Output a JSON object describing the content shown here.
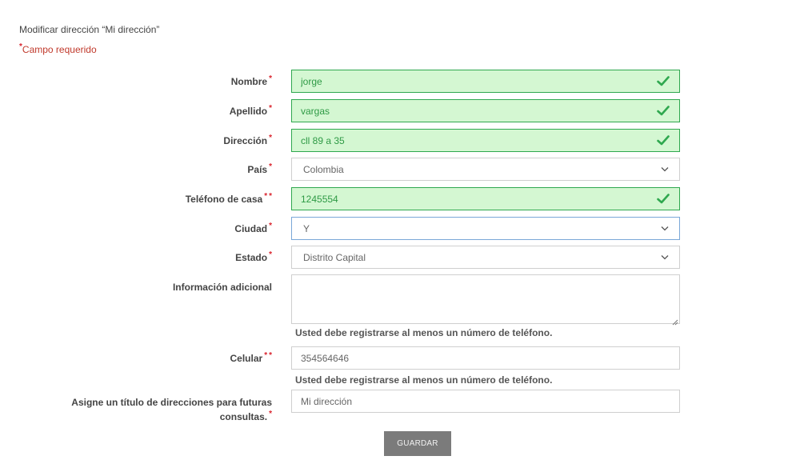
{
  "page": {
    "title": "Modificar dirección “Mi dirección”",
    "required_marker": "*",
    "required_note": "Campo requerido"
  },
  "form": {
    "fields": [
      {
        "label": "Nombre",
        "value": "jorge",
        "state": "valid",
        "type": "text"
      },
      {
        "label": "Apellido",
        "value": "vargas",
        "state": "valid",
        "type": "text"
      },
      {
        "label": "Dirección",
        "value": "cll 89 a 35",
        "state": "valid",
        "type": "text"
      },
      {
        "label": "País",
        "value": "Colombia",
        "state": "default",
        "type": "select"
      },
      {
        "label": "Teléfono de casa",
        "value": "1245554",
        "state": "valid",
        "type": "text"
      },
      {
        "label": "Ciudad",
        "value": "Y",
        "state": "focused",
        "type": "select"
      },
      {
        "label": "Estado",
        "value": "Distrito Capital",
        "state": "default",
        "type": "select"
      },
      {
        "label": "Información adicional",
        "value": "",
        "state": "default",
        "type": "textarea"
      },
      {
        "label": "Celular",
        "value": "354564646",
        "state": "default",
        "type": "text"
      },
      {
        "label": "Asigne un título de direcciones para futuras consultas.",
        "label_line1": "Asigne un título de direcciones para futuras",
        "label_line2": "consultas.",
        "value": "Mi dirección",
        "state": "default",
        "type": "text"
      }
    ],
    "phone_hint": "Usted debe registrarse al menos un número de teléfono.",
    "save_label": "GUARDAR"
  },
  "colors": {
    "valid_bg": "#d4f7d2",
    "valid_border": "#2fa84f",
    "valid_text": "#2e9a45",
    "required": "#d9232d",
    "button_bg": "#7b7b7b"
  },
  "icons": {
    "valid": "check-icon",
    "select": "chevron-down-icon",
    "textarea": "resize-handle-icon"
  }
}
